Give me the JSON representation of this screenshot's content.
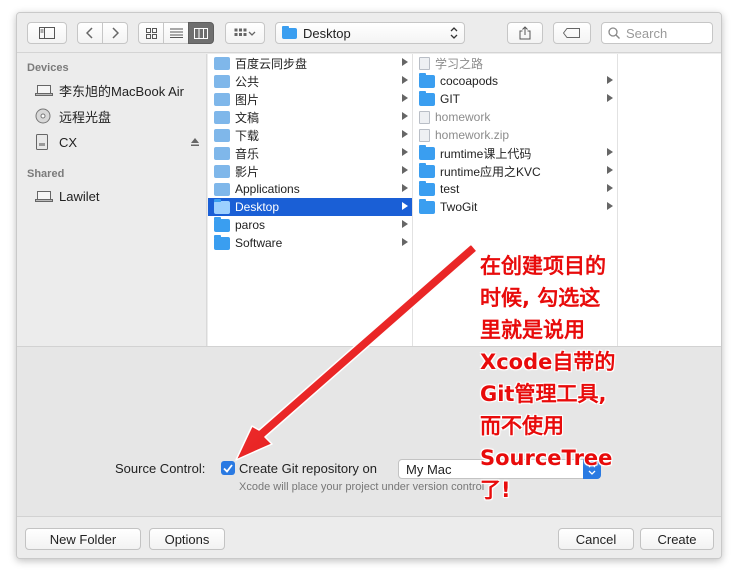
{
  "toolbar": {
    "path_label": "Desktop",
    "search_placeholder": "Search"
  },
  "sidebar": {
    "devices_header": "Devices",
    "devices": [
      {
        "label": "李东旭的MacBook Air",
        "icon": "laptop-icon"
      },
      {
        "label": "远程光盘",
        "icon": "optical-disc-icon"
      },
      {
        "label": "CX",
        "icon": "external-drive-icon"
      }
    ],
    "shared_header": "Shared",
    "shared": [
      {
        "label": "Lawilet",
        "icon": "network-computer-icon"
      }
    ]
  },
  "column1": [
    {
      "label": "百度云同步盘",
      "has_children": true
    },
    {
      "label": "公共",
      "has_children": true
    },
    {
      "label": "图片",
      "has_children": true
    },
    {
      "label": "文稿",
      "has_children": true
    },
    {
      "label": "下载",
      "has_children": true
    },
    {
      "label": "音乐",
      "has_children": true
    },
    {
      "label": "影片",
      "has_children": true
    },
    {
      "label": "Applications",
      "has_children": true
    },
    {
      "label": "Desktop",
      "has_children": true,
      "selected": true
    },
    {
      "label": "paros",
      "has_children": true
    },
    {
      "label": "Software",
      "has_children": true
    }
  ],
  "column2": [
    {
      "label": "学习之路",
      "kind": "dim-doc"
    },
    {
      "label": "cocoapods",
      "kind": "folder",
      "has_children": true
    },
    {
      "label": "GIT",
      "kind": "folder",
      "has_children": true
    },
    {
      "label": "homework",
      "kind": "dim-doc"
    },
    {
      "label": "homework.zip",
      "kind": "dim-doc"
    },
    {
      "label": "rumtime课上代码",
      "kind": "folder",
      "has_children": true
    },
    {
      "label": "runtime应用之KVC",
      "kind": "folder",
      "has_children": true
    },
    {
      "label": "test",
      "kind": "folder",
      "has_children": true
    },
    {
      "label": "TwoGit",
      "kind": "folder",
      "has_children": true
    }
  ],
  "options": {
    "source_control_label": "Source Control:",
    "checkbox_label": "Create Git repository on",
    "checkbox_checked": true,
    "location_select_value": "My Mac",
    "hint": "Xcode will place your project under version control"
  },
  "buttons": {
    "new_folder": "New Folder",
    "options": "Options",
    "cancel": "Cancel",
    "create": "Create"
  },
  "annotation": {
    "text": "在创建项目的\n时候, 勾选这\n里就是说用\nXcode自带的\nGit管理工具,\n而不使用\nSourceTree\n了!",
    "color": "#e80b0b"
  },
  "colors": {
    "selection": "#1a5fd6",
    "folder": "#3a9ef0",
    "checkbox": "#2a7ae2"
  }
}
